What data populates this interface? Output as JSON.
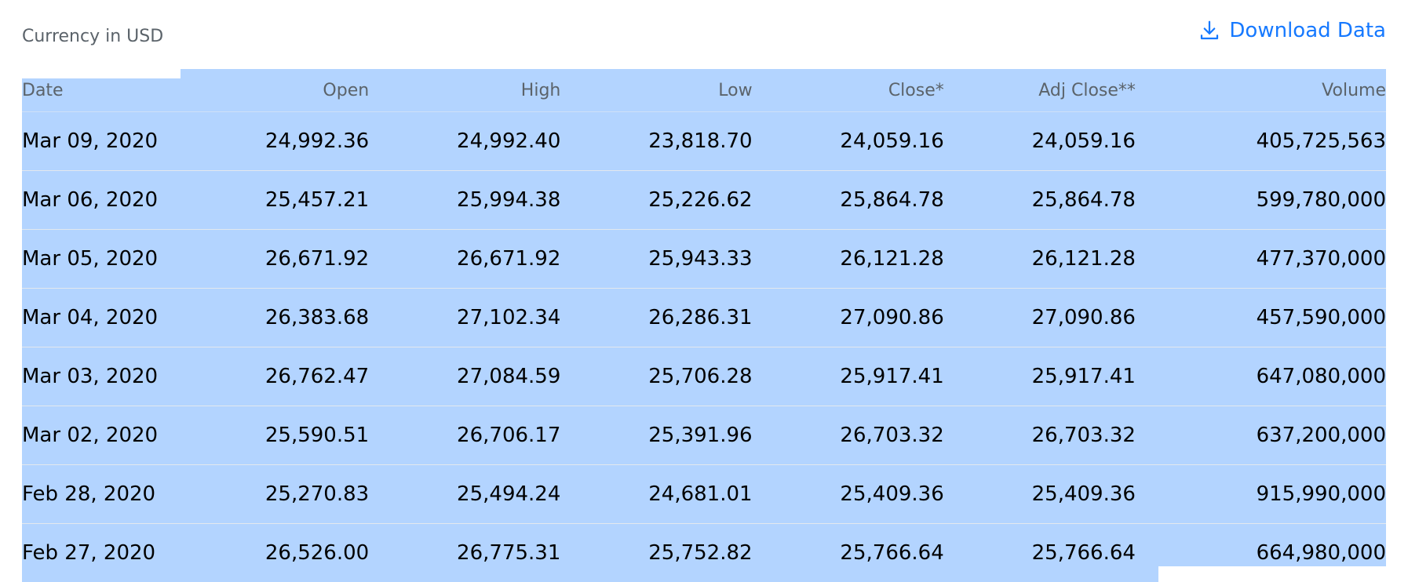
{
  "page": {
    "currency_label": "Currency in USD",
    "download_label": "Download Data",
    "accent_color": "#1679ff",
    "selection_color": "#b3d4ff"
  },
  "table": {
    "headers": [
      "Date",
      "Open",
      "High",
      "Low",
      "Close*",
      "Adj Close**",
      "Volume"
    ],
    "rows": [
      {
        "date": "Mar 09, 2020",
        "open": "24,992.36",
        "high": "24,992.40",
        "low": "23,818.70",
        "close": "24,059.16",
        "adj_close": "24,059.16",
        "volume": "405,725,563"
      },
      {
        "date": "Mar 06, 2020",
        "open": "25,457.21",
        "high": "25,994.38",
        "low": "25,226.62",
        "close": "25,864.78",
        "adj_close": "25,864.78",
        "volume": "599,780,000"
      },
      {
        "date": "Mar 05, 2020",
        "open": "26,671.92",
        "high": "26,671.92",
        "low": "25,943.33",
        "close": "26,121.28",
        "adj_close": "26,121.28",
        "volume": "477,370,000"
      },
      {
        "date": "Mar 04, 2020",
        "open": "26,383.68",
        "high": "27,102.34",
        "low": "26,286.31",
        "close": "27,090.86",
        "adj_close": "27,090.86",
        "volume": "457,590,000"
      },
      {
        "date": "Mar 03, 2020",
        "open": "26,762.47",
        "high": "27,084.59",
        "low": "25,706.28",
        "close": "25,917.41",
        "adj_close": "25,917.41",
        "volume": "647,080,000"
      },
      {
        "date": "Mar 02, 2020",
        "open": "25,590.51",
        "high": "26,706.17",
        "low": "25,391.96",
        "close": "26,703.32",
        "adj_close": "26,703.32",
        "volume": "637,200,000"
      },
      {
        "date": "Feb 28, 2020",
        "open": "25,270.83",
        "high": "25,494.24",
        "low": "24,681.01",
        "close": "25,409.36",
        "adj_close": "25,409.36",
        "volume": "915,990,000"
      },
      {
        "date": "Feb 27, 2020",
        "open": "26,526.00",
        "high": "26,775.31",
        "low": "25,752.82",
        "close": "25,766.64",
        "adj_close": "25,766.64",
        "volume": "664,980,000"
      }
    ]
  },
  "icons": {
    "download": "download-icon"
  }
}
